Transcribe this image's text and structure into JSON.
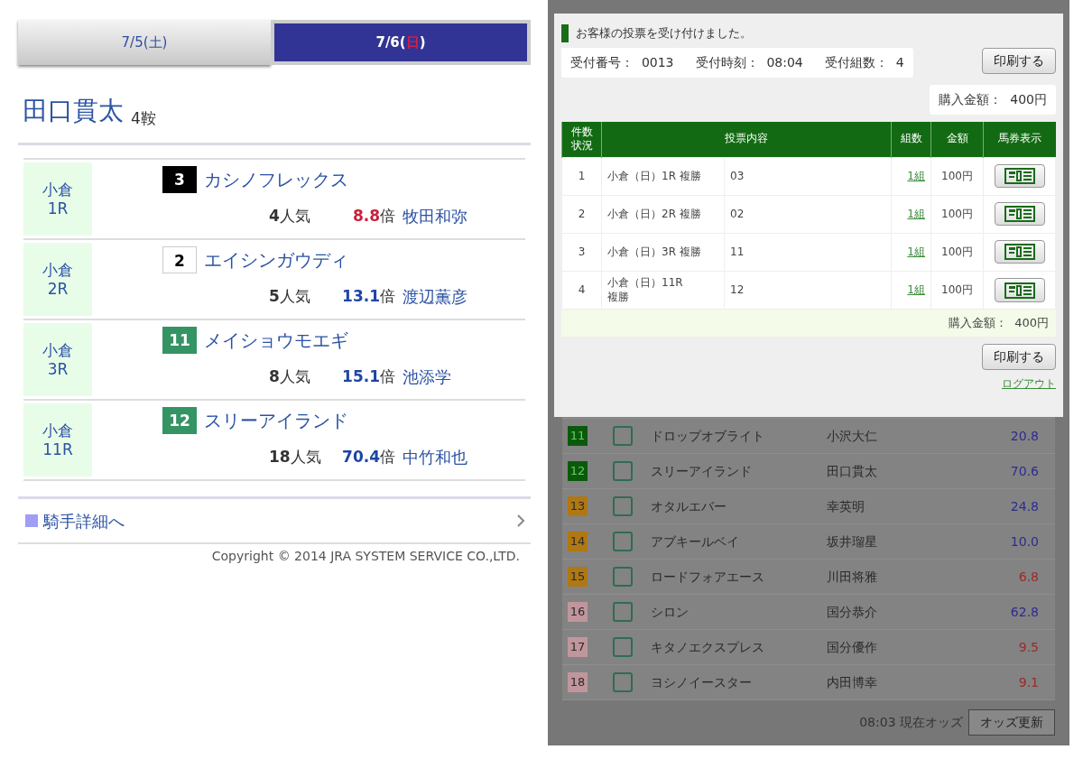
{
  "left": {
    "tabs": [
      {
        "prefix": "7/5(",
        "weekday": "土",
        "suffix": ")",
        "sunday": false,
        "selected": false
      },
      {
        "prefix": "7/6(",
        "weekday": "日",
        "suffix": ")",
        "sunday": true,
        "selected": true
      }
    ],
    "jockey": {
      "name": "田口貫太",
      "rides": "4鞍"
    },
    "races": [
      {
        "venue": "小倉",
        "race": "1R",
        "number": "3",
        "color": "#000000",
        "horse": "カシノフレックス",
        "popularity": "**4**人気",
        "odds": "**8.8**倍",
        "hot": true,
        "rider": "牧田和弥"
      },
      {
        "venue": "小倉",
        "race": "2R",
        "number": "2",
        "color": "#ffffff",
        "horse": "エイシンガウディ",
        "popularity": "**5**人気",
        "odds": "**13.1**倍",
        "hot": false,
        "rider": "渡辺薫彦"
      },
      {
        "venue": "小倉",
        "race": "3R",
        "number": "11",
        "color": "#359463",
        "horse": "メイショウモエギ",
        "popularity": "**8**人気",
        "odds": "**15.1**倍",
        "hot": false,
        "rider": "池添学"
      },
      {
        "venue": "小倉",
        "race": "11R",
        "number": "12",
        "color": "#359463",
        "horse": "スリーアイランド",
        "popularity": "**18**人気",
        "odds": "**70.4**倍",
        "hot": false,
        "rider": "中竹和也"
      }
    ],
    "detail_link": "騎手詳細へ",
    "copyright": "Copyright © 2014 JRA SYSTEM SERVICE CO.,LTD."
  },
  "right": {
    "modal": {
      "message": "お客様の投票を受け付けました。",
      "receipt_number": "受付番号：  0013",
      "receipt_time": "受付時刻：  08:04",
      "receipt_count": "受付組数：  4",
      "print_button": "印刷する",
      "total_top": "購入金額：  400円",
      "columns": [
        "件数状況",
        "投票内容",
        "組数",
        "金額",
        "馬券表示"
      ],
      "rows": [
        {
          "no": "1",
          "bet": "小倉（日）1R  複勝",
          "selection": "03",
          "combos": "1組",
          "amount": "100円"
        },
        {
          "no": "2",
          "bet": "小倉（日）2R  複勝",
          "selection": "02",
          "combos": "1組",
          "amount": "100円"
        },
        {
          "no": "3",
          "bet": "小倉（日）3R  複勝",
          "selection": "11",
          "combos": "1組",
          "amount": "100円"
        },
        {
          "no": "4",
          "bet": "小倉（日）11R\n複勝",
          "selection": "12",
          "combos": "1組",
          "amount": "100円"
        }
      ],
      "total_bottom": "購入金額：  400円",
      "print_button_bottom": "印刷する",
      "logout": "ログアウト"
    },
    "entries": [
      {
        "number": "11",
        "color": "#0b5a0b",
        "checked": false,
        "horse": "ドロップオブライト",
        "rider": "小沢大仁",
        "odds": "20.8",
        "hot": false
      },
      {
        "number": "12",
        "color": "#0b5a0b",
        "checked": false,
        "horse": "スリーアイランド",
        "rider": "田口貫太",
        "odds": "70.6",
        "hot": false
      },
      {
        "number": "13",
        "color": "#b07812",
        "checked": false,
        "horse": "オタルエバー",
        "rider": "幸英明",
        "odds": "24.8",
        "hot": false
      },
      {
        "number": "14",
        "color": "#b07812",
        "checked": false,
        "horse": "アブキールベイ",
        "rider": "坂井瑠星",
        "odds": "10.0",
        "hot": false
      },
      {
        "number": "15",
        "color": "#b07812",
        "checked": false,
        "horse": "ロードフォアエース",
        "rider": "川田将雅",
        "odds": "6.8",
        "hot": true
      },
      {
        "number": "16",
        "color": "#c0969c",
        "checked": false,
        "horse": "シロン",
        "rider": "国分恭介",
        "odds": "62.8",
        "hot": false
      },
      {
        "number": "17",
        "color": "#c0969c",
        "checked": false,
        "horse": "キタノエクスプレス",
        "rider": "国分優作",
        "odds": "9.5",
        "hot": true
      },
      {
        "number": "18",
        "color": "#c0969c",
        "checked": false,
        "horse": "ヨシノイースター",
        "rider": "内田博幸",
        "odds": "9.1",
        "hot": true
      }
    ],
    "odds_time": "08:03 現在オッズ",
    "odds_button": "オッズ更新"
  }
}
